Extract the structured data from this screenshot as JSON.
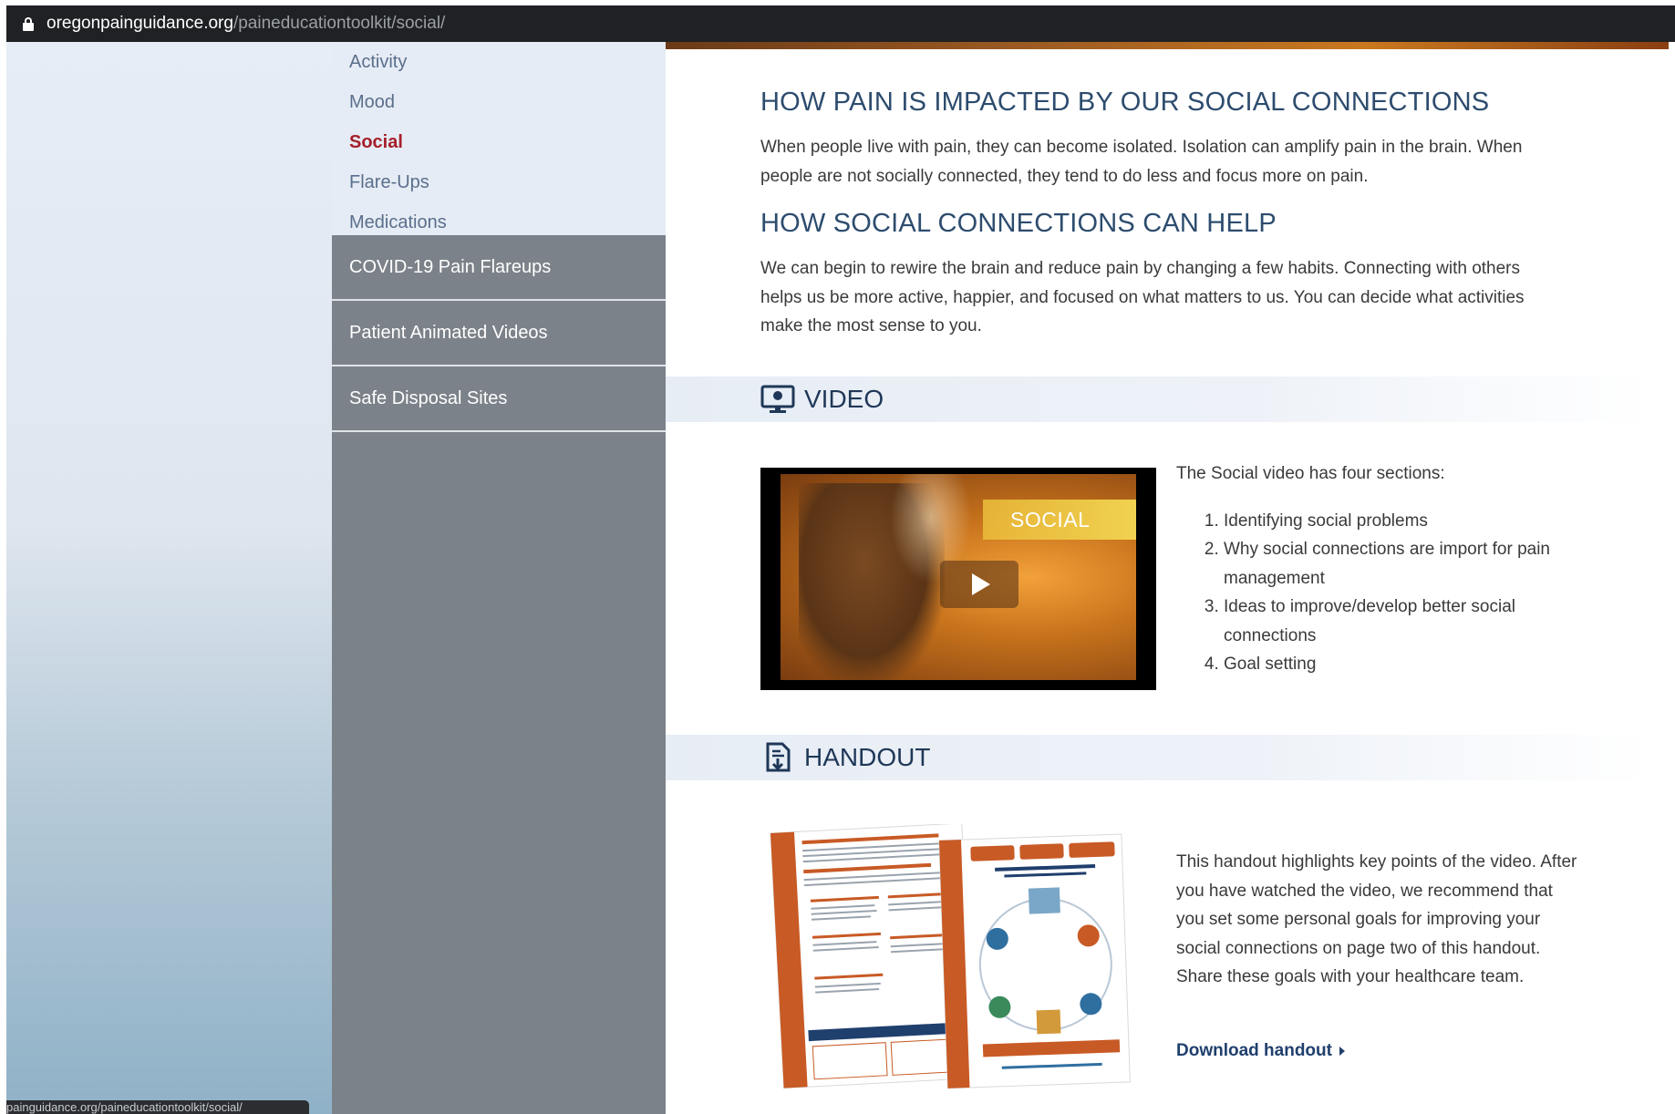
{
  "browser": {
    "url_host": "oregonpainguidance.org",
    "url_path": "/paineducationtoolkit/social/",
    "status_url": "painguidance.org/paineducationtoolkit/social/"
  },
  "sidebar": {
    "subnav": [
      {
        "label": "Activity",
        "active": false
      },
      {
        "label": "Mood",
        "active": false
      },
      {
        "label": "Social",
        "active": true
      },
      {
        "label": "Flare-Ups",
        "active": false
      },
      {
        "label": "Medications",
        "active": false
      }
    ],
    "mainnav": [
      {
        "label": "COVID-19 Pain Flareups"
      },
      {
        "label": "Patient Animated Videos"
      },
      {
        "label": "Safe Disposal Sites"
      }
    ]
  },
  "content": {
    "impact_heading": "HOW PAIN IS IMPACTED BY OUR SOCIAL CONNECTIONS",
    "impact_text": "When people live with pain, they can become isolated. Isolation can amplify pain in the brain. When people are not socially connected, they tend to do less and focus more on pain.",
    "help_heading": "HOW SOCIAL CONNECTIONS CAN HELP",
    "help_text": "We can begin to rewire the brain and reduce pain by changing a few habits. Connecting with others helps us be more active, happier, and focused on what matters to us. You can decide what activities make the most sense to you.",
    "video_section_title": "VIDEO",
    "video_thumb_label": "SOCIAL",
    "video_intro": "The Social video has four sections:",
    "video_sections": [
      "Identifying social problems",
      "Why social connections are import for pain management",
      "Ideas to improve/develop better social connections",
      "Goal setting"
    ],
    "handout_section_title": "HANDOUT",
    "handout_text": "This handout highlights key points of the video. After you have watched the video, we recommend that you set some personal goals for improving your social connections on page two of this handout. Share these goals with your healthcare team.",
    "download_label": "Download handout"
  },
  "colors": {
    "heading": "#2d4c6e",
    "active_nav": "#a51f2a",
    "sidebar_bg": "#7c8289",
    "subnav_bg": "#e6ecf5",
    "handout_orange": "#c85a25"
  }
}
